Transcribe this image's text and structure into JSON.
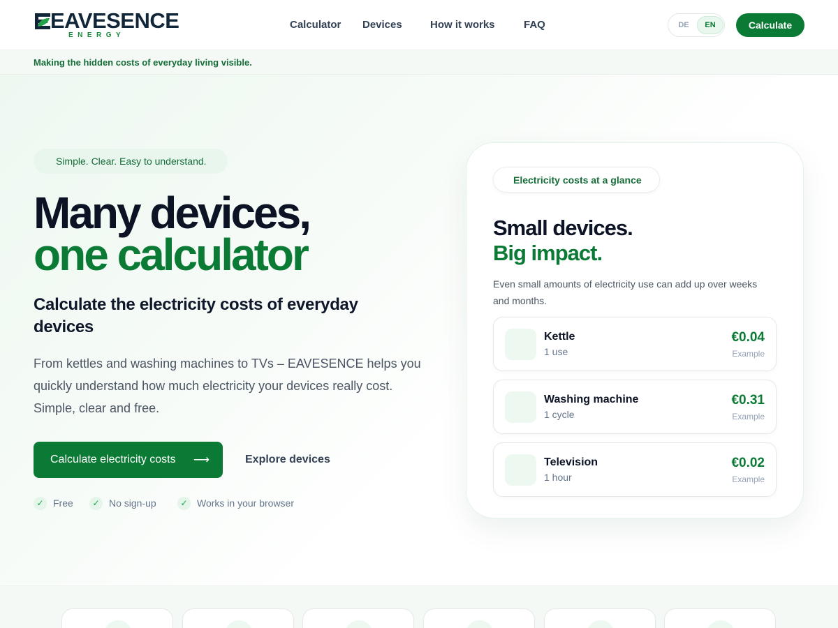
{
  "brand": {
    "name": "EAVESENCE",
    "sub": "ENERGY",
    "logo_icon": "leaf-icon",
    "accent": "#0b7a35",
    "accent_light": "#1c8a3e"
  },
  "nav": {
    "links": [
      "Calculator",
      "Devices",
      "How it works",
      "FAQ"
    ],
    "lang": {
      "de": "DE",
      "en": "EN",
      "selected": "EN"
    },
    "cta": "Calculate"
  },
  "strip": {
    "text": "Making the hidden costs of everyday living visible."
  },
  "hero": {
    "pill": "Simple. Clear. Easy to understand.",
    "title_line1": "Many devices,",
    "title_line2": "one calculator",
    "subtitle": "Calculate the electricity costs of everyday devices",
    "lead": "From kettles and washing machines to TVs – EAVESENCE helps you quickly understand how much electricity your devices really cost. Simple, clear and free.",
    "primary_cta": "Calculate electricity costs",
    "primary_cta_icon": "arrow-right-icon",
    "secondary_cta": "Explore devices",
    "features": [
      "Free",
      "No sign-up",
      "Works in your browser"
    ]
  },
  "glance": {
    "pill": "Electricity costs at a glance",
    "title_line1": "Small devices.",
    "title_line2": "Big impact.",
    "desc": "Even small amounts of electricity use can add up over weeks and months.",
    "devices": [
      {
        "name": "Kettle",
        "usage": "1 use",
        "cost": "€0.04",
        "note": "Example"
      },
      {
        "name": "Washing machine",
        "usage": "1 cycle",
        "cost": "€0.31",
        "note": "Example"
      },
      {
        "name": "Television",
        "usage": "1 hour",
        "cost": "€0.02",
        "note": "Example"
      }
    ]
  }
}
